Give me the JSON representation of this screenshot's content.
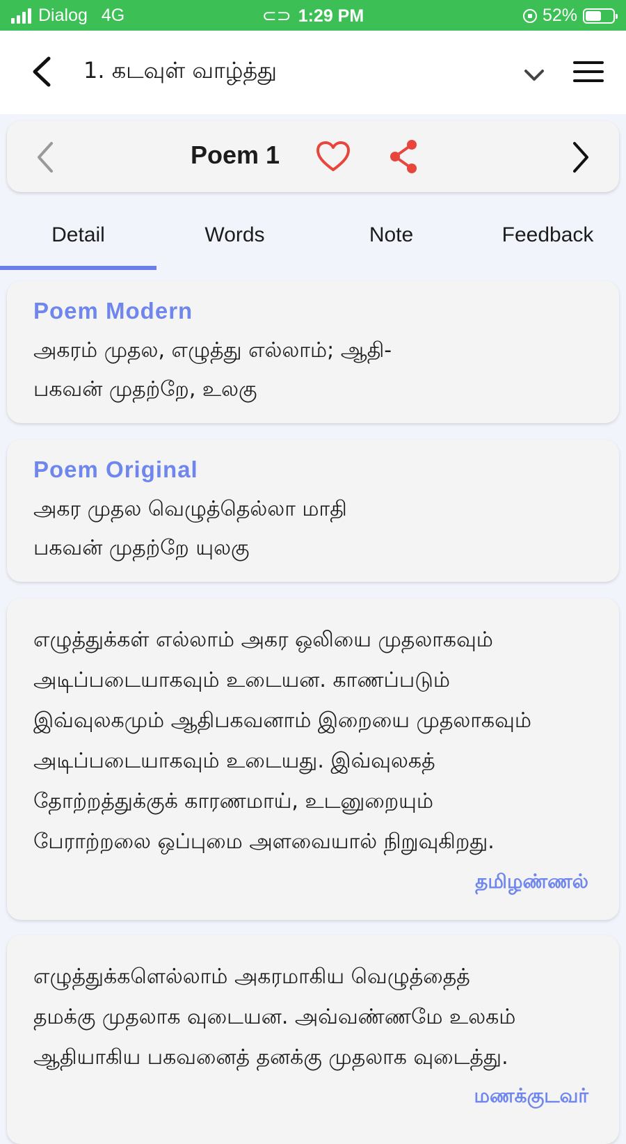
{
  "status": {
    "carrier": "Dialog",
    "network": "4G",
    "time": "1:29 PM",
    "battery": "52%",
    "battery_level": 0.52
  },
  "appbar": {
    "title": "1. கடவுள் வாழ்த்து",
    "back_icon": "chevron-left-icon",
    "dropdown_icon": "chevron-down-icon",
    "menu_icon": "hamburger-menu-icon"
  },
  "poem_nav": {
    "title": "Poem 1",
    "favorite_icon": "heart-icon",
    "share_icon": "share-icon",
    "accent": "#e8453c"
  },
  "tabs": [
    {
      "label": "Detail",
      "active": true
    },
    {
      "label": "Words",
      "active": false
    },
    {
      "label": "Note",
      "active": false
    },
    {
      "label": "Feedback",
      "active": false
    }
  ],
  "cards": {
    "modern": {
      "heading": "Poem Modern",
      "lines": [
        "அகரம் முதல, எழுத்து எல்லாம்; ஆதி-",
        "பகவன் முதற்றே, உலகு"
      ]
    },
    "original": {
      "heading": "Poem Original",
      "lines": [
        "அகர முதல வெழுத்தெல்லா மாதி",
        "பகவன் முதற்றே யுலகு"
      ]
    },
    "explanation1": {
      "lines": [
        "எழுத்துக்கள் எல்லாம் அகர ஒலியை முதலாகவும்",
        "அடிப்படையாகவும் உடையன. காணப்படும்",
        "இவ்வுலகமும் ஆதிபகவனாம் இறையை முதலாகவும்",
        "அடிப்படையாகவும் உடையது. இவ்வுலகத்",
        "தோற்றத்துக்குக் காரணமாய், உடனுறையும்",
        "பேராற்றலை ஒப்புமை அளவையால் நிறுவுகிறது."
      ],
      "author": "தமிழண்ணல்"
    },
    "explanation2": {
      "lines": [
        "எழுத்துக்களெல்லாம் அகரமாகிய வெழுத்தைத்",
        "தமக்கு முதலாக வுடையன. அவ்வண்ணமே உலகம்",
        "ஆதியாகிய பகவனைத் தனக்கு முதலாக வுடைத்து."
      ],
      "author": "மணக்குடவர்"
    }
  },
  "colors": {
    "status_bar": "#3cbf55",
    "accent": "#6f86ec",
    "tab_indicator": "#6c7ee8"
  }
}
